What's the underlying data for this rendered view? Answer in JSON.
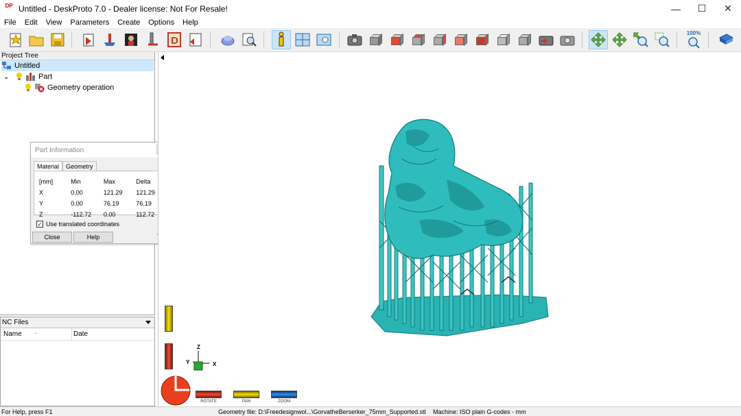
{
  "window": {
    "title": "Untitled - DeskProto 7.0 - Dealer license: Not For Resale!",
    "logo_text": "DP",
    "minimize": "—",
    "maximize": "☐",
    "close": "✕"
  },
  "menu": [
    "File",
    "Edit",
    "View",
    "Parameters",
    "Create",
    "Options",
    "Help"
  ],
  "toolbar": {
    "zoom_level": "100%"
  },
  "project_tree": {
    "header": "Project Tree",
    "root": "Untitled",
    "part": "Part",
    "operation": "Geometry operation"
  },
  "nc_files": {
    "header": "NC Files",
    "col_name": "Name",
    "col_date": "Date"
  },
  "part_info": {
    "title": "Part Information",
    "tabs": [
      "Material",
      "Geometry"
    ],
    "headers": [
      "[mm]",
      "Min",
      "Max",
      "Delta"
    ],
    "rows": [
      {
        "axis": "X",
        "min": "0.00",
        "max": "121.29",
        "delta": "121.29"
      },
      {
        "axis": "Y",
        "min": "0.00",
        "max": "76.19",
        "delta": "76.19"
      },
      {
        "axis": "Z",
        "min": "-112.72",
        "max": "0.00",
        "delta": "112.72"
      }
    ],
    "checkbox_label": "Use translated coordinates",
    "checkbox_checked": true,
    "close_label": "Close",
    "help_label": "Help"
  },
  "viewport": {
    "axis_x": "X",
    "axis_y": "Y",
    "axis_z": "Z",
    "rotate_label": "ROTATE",
    "pan_label": "PAN",
    "zoom_label": "ZOOM",
    "model_color": "#2ab3b3"
  },
  "status": {
    "help": "For Help, press F1",
    "geometry_file": "Geometry file: D:\\Freedesignwol...\\GorvatheBerserker_75mm_Supported.stl",
    "machine": "Machine: ISO plain G-codes - mm"
  }
}
